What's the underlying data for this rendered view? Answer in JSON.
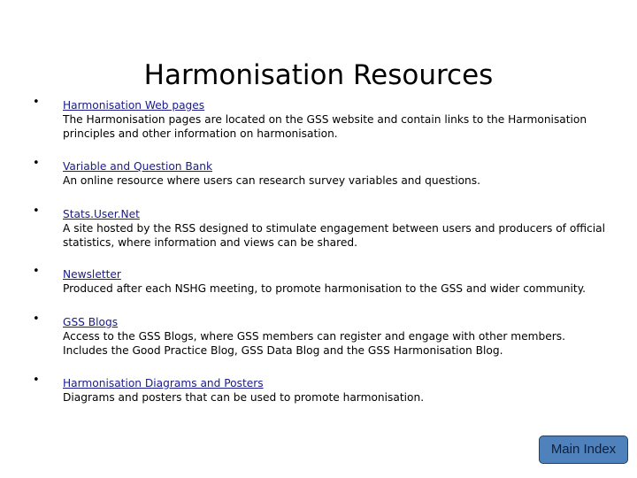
{
  "page": {
    "title": "Harmonisation Resources"
  },
  "resources": [
    {
      "link": "Harmonisation Web pages",
      "description": "The Harmonisation pages are located on the GSS website and contain links to the Harmonisation\nprinciples and other information on harmonisation."
    },
    {
      "link": "Variable and Question Bank",
      "description": "An online resource where users can research survey variables and questions."
    },
    {
      "link": "Stats.User.Net",
      "description": "A site hosted by the RSS designed to stimulate engagement between users and producers of official\nstatistics, where information and views can be shared."
    },
    {
      "link": "Newsletter",
      "description": "Produced after each NSHG meeting, to promote harmonisation to the GSS and wider community."
    },
    {
      "link": "GSS Blogs",
      "description": "Access to the GSS Blogs, where GSS members can register and engage with other members.\nIncludes the Good Practice Blog, GSS Data Blog and the GSS Harmonisation Blog."
    },
    {
      "link": "Harmonisation Diagrams and Posters",
      "description": "Diagrams and posters that can be used to promote harmonisation."
    }
  ],
  "bullet_glyph": "•",
  "navigation": {
    "main_index_label": "Main Index"
  },
  "colors": {
    "link": "#1a1a8c",
    "button_fill": "#4f81bd",
    "button_border": "#243f60"
  }
}
